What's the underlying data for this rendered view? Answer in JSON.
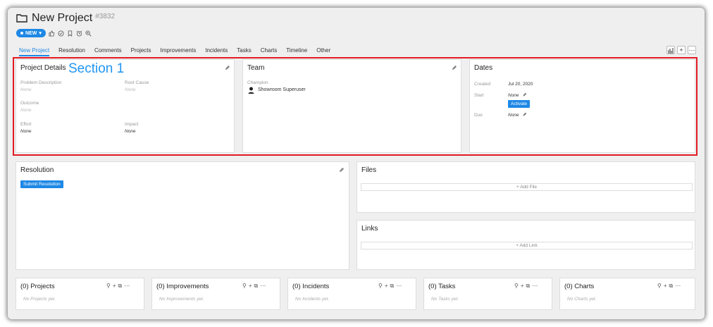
{
  "header": {
    "title": "New Project",
    "project_number": "#3832"
  },
  "status": {
    "label": "NEW"
  },
  "tabs": [
    "New Project",
    "Resolution",
    "Comments",
    "Projects",
    "Improvements",
    "Incidents",
    "Tasks",
    "Charts",
    "Timeline",
    "Other"
  ],
  "annotation": {
    "label": "Section 1"
  },
  "project_details": {
    "title": "Project Details",
    "problem_description_label": "Problem Description",
    "problem_description_value": "None",
    "root_cause_label": "Root Cause",
    "root_cause_value": "None",
    "outcome_label": "Outcome",
    "outcome_value": "None",
    "effort_label": "Effort",
    "effort_value": "None",
    "impact_label": "Impact",
    "impact_value": "None"
  },
  "team": {
    "title": "Team",
    "champion_label": "Champion",
    "champion_name": "Showroom Superuser"
  },
  "dates": {
    "title": "Dates",
    "created_label": "Created",
    "created_value": "Jul 20, 2020",
    "start_label": "Start",
    "start_value": "None",
    "activate_label": "Activate",
    "due_label": "Due",
    "due_value": "None"
  },
  "resolution": {
    "title": "Resolution",
    "submit_label": "Submit Resolution"
  },
  "files": {
    "title": "Files",
    "add_label": "+ Add File"
  },
  "links": {
    "title": "Links",
    "add_label": "+ Add Link"
  },
  "subpanels": [
    {
      "title": "(0) Projects",
      "empty": "No Projects yet."
    },
    {
      "title": "(0) Improvements",
      "empty": "No Improvements yet."
    },
    {
      "title": "(0) Incidents",
      "empty": "No Incidents yet."
    },
    {
      "title": "(0) Tasks",
      "empty": "No Tasks yet."
    },
    {
      "title": "(0) Charts",
      "empty": "No Charts yet."
    }
  ],
  "colors": {
    "accent": "#1e88e5",
    "annotation_box": "#e31b23",
    "annotation_text": "#2196f3"
  }
}
